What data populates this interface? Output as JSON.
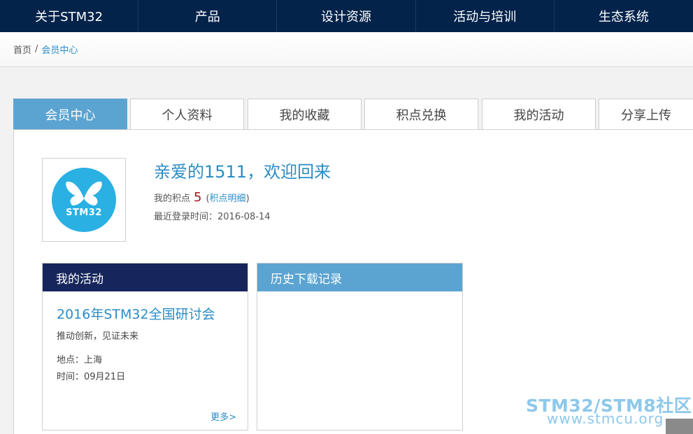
{
  "nav": {
    "items": [
      {
        "label": "关于STM32"
      },
      {
        "label": "产品"
      },
      {
        "label": "设计资源"
      },
      {
        "label": "活动与培训"
      },
      {
        "label": "生态系统"
      }
    ]
  },
  "breadcrumb": {
    "home": "首页",
    "separator": "/",
    "current": "会员中心"
  },
  "tabs": [
    {
      "label": "会员中心",
      "active": true
    },
    {
      "label": "个人资料"
    },
    {
      "label": "我的收藏"
    },
    {
      "label": "积点兑换"
    },
    {
      "label": "我的活动"
    },
    {
      "label": "分享上传"
    }
  ],
  "profile": {
    "avatar_text": "STM32",
    "avatar_icon": "butterfly-icon",
    "welcome": "亲爱的1511，欢迎回来",
    "points_label": "我的积点",
    "points_value": "5",
    "points_paren_open": "(",
    "points_detail_link": "积点明细",
    "points_paren_close": ")",
    "last_login": "最近登录时间：2016-08-14"
  },
  "activity_card": {
    "title": "我的活动",
    "event_title": "2016年STM32全国研讨会",
    "event_subtitle": "推动创新，见证未来",
    "location": "地点：上海",
    "time": "时间：09月21日",
    "more": "更多>"
  },
  "history_card": {
    "title": "历史下载记录"
  },
  "watermark": {
    "line1": "STM32/STM8社区",
    "line2": "www.stmcu.org"
  },
  "colors": {
    "nav_bg": "#03234b",
    "accent_blue": "#5ba4d2",
    "link_blue": "#2a8cc6",
    "card_dark": "#16265c",
    "points_red": "#b0101c",
    "avatar_blue": "#2ab0e3"
  }
}
